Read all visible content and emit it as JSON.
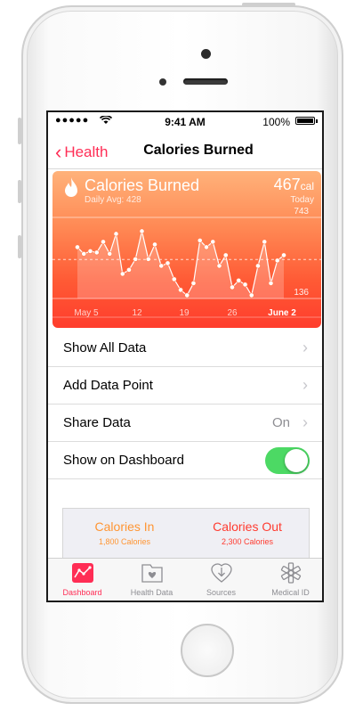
{
  "status": {
    "carrier": "●●●●● ",
    "time": "9:41 AM",
    "battery": "100%"
  },
  "nav": {
    "back_label": "Health",
    "title": "Calories Burned"
  },
  "chart_data": {
    "type": "line",
    "title": "Calories Burned",
    "subtitle": "Daily Avg: 428",
    "current_value": "467",
    "current_unit": "cal",
    "current_label": "Today",
    "ymax_label": "743",
    "ymin_label": "136",
    "ylim": [
      136,
      743
    ],
    "average": 428,
    "x_labels": [
      "May 5",
      "12",
      "19",
      "26",
      "June 2"
    ],
    "values": [
      520,
      470,
      490,
      480,
      560,
      470,
      620,
      320,
      350,
      430,
      640,
      430,
      540,
      380,
      400,
      280,
      200,
      160,
      250,
      570,
      520,
      560,
      380,
      460,
      220,
      270,
      240,
      160,
      380,
      560,
      250,
      420,
      460
    ],
    "colors": {
      "top": "#ffb27a",
      "bottom": "#ff3d2c",
      "line": "#ffffff"
    }
  },
  "rows": [
    {
      "label": "Show All Data",
      "value": ""
    },
    {
      "label": "Add Data Point",
      "value": ""
    },
    {
      "label": "Share Data",
      "value": "On"
    },
    {
      "label": "Show on Dashboard",
      "value": ""
    }
  ],
  "toggle": {
    "on": true,
    "color": "#4cd964"
  },
  "calories": {
    "in_title": "Calories In",
    "in_value": "1,800 Calories",
    "in_color": "#ff9533",
    "out_title": "Calories Out",
    "out_value": "2,300 Calories",
    "out_color": "#ff3b30"
  },
  "tabs": [
    {
      "label": "Dashboard",
      "icon": "dashboard-icon",
      "active": true
    },
    {
      "label": "Health Data",
      "icon": "health-data-icon",
      "active": false
    },
    {
      "label": "Sources",
      "icon": "sources-icon",
      "active": false
    },
    {
      "label": "Medical ID",
      "icon": "medical-id-icon",
      "active": false
    }
  ],
  "accent": "#ff2d55"
}
